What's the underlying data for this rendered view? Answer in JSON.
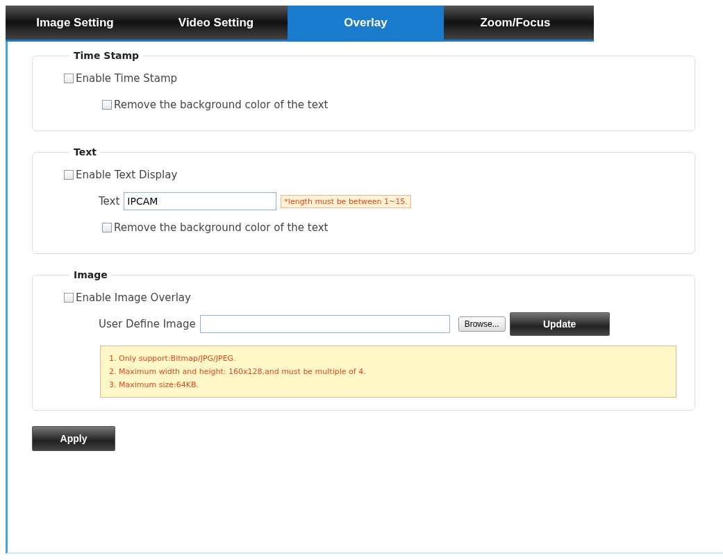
{
  "tabs": [
    {
      "label": "Image Setting",
      "selected": false
    },
    {
      "label": "Video Setting",
      "selected": false
    },
    {
      "label": "Overlay",
      "selected": true
    },
    {
      "label": "Zoom/Focus",
      "selected": false
    }
  ],
  "sections": [
    {
      "legend": "Time Stamp",
      "items": [
        {
          "kind": "checkbox",
          "label": "Enable Time Stamp",
          "checked": false,
          "children": [
            {
              "kind": "checkbox",
              "label": "Remove the background color of the text",
              "checked": false
            }
          ]
        }
      ]
    },
    {
      "legend": "Text",
      "items": [
        {
          "kind": "checkbox",
          "label": "Enable Text Display",
          "checked": false,
          "children": [
            {
              "kind": "text",
              "label": "Text",
              "value": "IPCAM",
              "hint": "*length must be between 1~15."
            },
            {
              "kind": "checkbox",
              "label": "Remove the background color of the text",
              "checked": false
            }
          ]
        }
      ]
    },
    {
      "legend": "Image",
      "items": [
        {
          "kind": "checkbox",
          "label": "Enable Image Overlay",
          "checked": false,
          "children": [
            {
              "kind": "file",
              "label": "User Define Image",
              "browse": "Browse...",
              "update": "Update"
            },
            {
              "kind": "note",
              "lines": [
                "1. Only support:Bitmap/JPG/JPEG.",
                "2. Maximum width and height: 160x128,and must be multiple of 4.",
                "3. Maximum size:64KB."
              ]
            }
          ]
        }
      ]
    }
  ],
  "apply": "Apply"
}
